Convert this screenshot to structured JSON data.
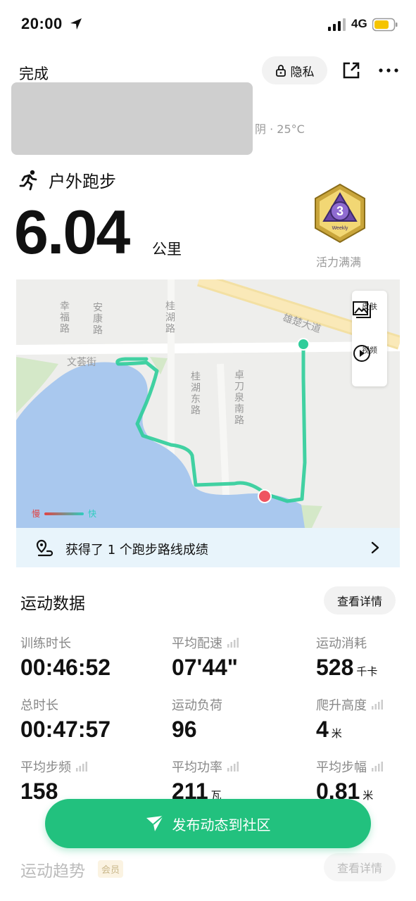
{
  "status_bar": {
    "time": "20:00",
    "network": "4G",
    "battery_color": "#f5c400"
  },
  "header": {
    "done_label": "完成",
    "privacy_label": "隐私",
    "weather": "阴 · 25°C"
  },
  "workout": {
    "type": "户外跑步",
    "distance": "6.04",
    "distance_unit": "公里",
    "badge_text": "Weekly",
    "badge_label": "活力满满"
  },
  "map": {
    "streets": [
      "幸福路",
      "安康路",
      "桂湖路",
      "文荟街",
      "桂湖东路",
      "卓刀泉南路",
      "雄楚大道"
    ],
    "tools": [
      {
        "icon": "image-icon",
        "label": "皮肤"
      },
      {
        "icon": "play-icon",
        "label": "视频"
      }
    ],
    "legend_slow": "慢",
    "legend_fast": "快",
    "route_color": "#2ecd9a",
    "water_color": "#a9c8ee"
  },
  "route_banner": {
    "text": "获得了 1 个跑步路线成绩"
  },
  "sport_data": {
    "title": "运动数据",
    "detail_label": "查看详情",
    "stats": [
      {
        "label": "训练时长",
        "value": "00:46:52",
        "unit": ""
      },
      {
        "label": "平均配速",
        "value": "07'44\"",
        "unit": ""
      },
      {
        "label": "运动消耗",
        "value": "528",
        "unit": "千卡"
      },
      {
        "label": "总时长",
        "value": "00:47:57",
        "unit": ""
      },
      {
        "label": "运动负荷",
        "value": "96",
        "unit": ""
      },
      {
        "label": "爬升高度",
        "value": "4",
        "unit": "米"
      },
      {
        "label": "平均步频",
        "value": "158",
        "unit": ""
      },
      {
        "label": "平均功率",
        "value": "211",
        "unit": "瓦"
      },
      {
        "label": "平均步幅",
        "value": "0.81",
        "unit": "米"
      }
    ]
  },
  "publish_button": {
    "label": "发布动态到社区"
  },
  "trend": {
    "title": "运动趋势",
    "member_tag": "会员",
    "detail_label": "查看详情"
  }
}
